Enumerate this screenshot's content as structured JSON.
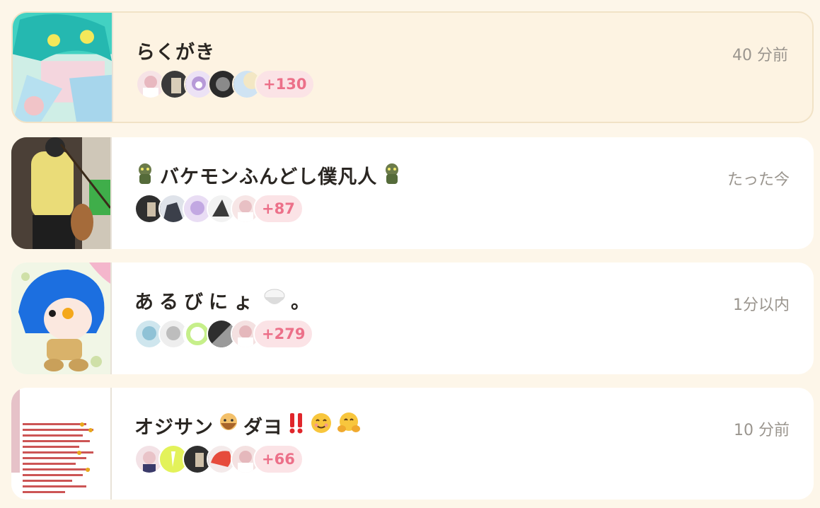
{
  "rooms": [
    {
      "title": "らくがき",
      "time": "40 分前",
      "more": "+130",
      "avatar_colors": [
        "#f6e3e6",
        "#3a3a3a",
        "#e7d6f3",
        "#2b2b2b",
        "#cfe3f3"
      ]
    },
    {
      "title_prefix_icon": "monster-emoji-icon",
      "title": "バケモンふんどし僕凡人",
      "title_suffix_icon": "monster-emoji-icon",
      "time": "たった今",
      "more": "+87",
      "avatar_colors": [
        "#2f2f2f",
        "#4a4a55",
        "#e9ddf4",
        "#f2f2f2",
        "#f7e6e6"
      ]
    },
    {
      "title": "あるびにょ",
      "title_suffix_icon": "rice-bowl-emoji-icon",
      "title_tail": "。",
      "time": "1分以内",
      "more": "+279",
      "avatar_colors": [
        "#cfe6ee",
        "#eeeeee",
        "#d9f3b8",
        "#2e2e2e",
        "#f4e1e1"
      ]
    },
    {
      "title": "オジサン",
      "title_icon_1": "old-man-emoji-icon",
      "title_mid": "ダヨ",
      "title_icons_2": [
        "double-exclamation-icon",
        "smiling-face-icon",
        "hugging-face-icon"
      ],
      "time": "10 分前",
      "more": "+66",
      "avatar_colors": [
        "#f3e2e6",
        "#e3f25a",
        "#2f2f2f",
        "#e64b3c",
        "#f4e1e1"
      ]
    }
  ]
}
